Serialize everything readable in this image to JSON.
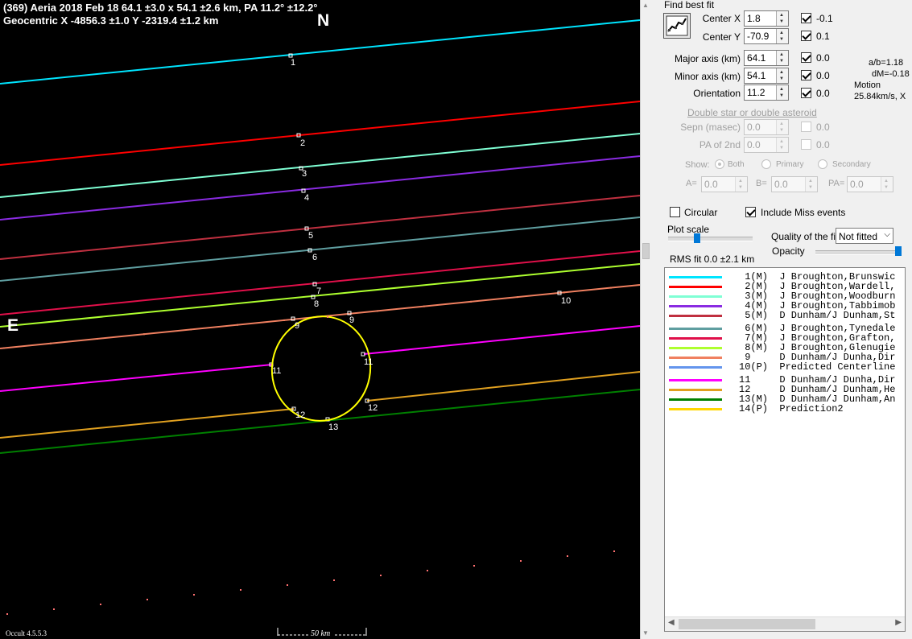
{
  "plot": {
    "title_line1": "(369) Aeria  2018 Feb 18   64.1 ±3.0 x 54.1 ±2.6 km,  PA 11.2° ±12.2°",
    "title_line2": "Geocentric  X  -4856.3 ±1.0  Y -2319.4 ±1.2 km",
    "north_label": "N",
    "east_label": "E",
    "version": "Occult 4.5.5.3",
    "scale_label": "50 km",
    "chord_numbers": [
      "1",
      "2",
      "3",
      "4",
      "5",
      "6",
      "7",
      "8",
      "9",
      "9",
      "10",
      "11",
      "11",
      "12",
      "12",
      "13"
    ],
    "colors": {
      "chord1": "#00e5ff",
      "chord2": "#ff0000",
      "chord3": "#7fffd4",
      "chord4": "#8a2be2",
      "chord5": "#c03040",
      "chord6": "#5f9ea0",
      "chord7": "#e0104a",
      "chord8": "#adff2f",
      "chord9": "#f08060",
      "chord11": "#ff00ff",
      "chord12": "#e0a020",
      "chord13": "#008000",
      "ellipse": "#ffff00"
    }
  },
  "panel": {
    "find_best_fit": "Find best fit",
    "fit_button_icon": "fit-graph-icon",
    "center_x": {
      "label": "Center X",
      "value": "1.8",
      "check_label": "-0.1",
      "checked": true
    },
    "center_y": {
      "label": "Center Y",
      "value": "-70.9",
      "check_label": "0.1",
      "checked": true
    },
    "major_axis": {
      "label": "Major axis (km)",
      "value": "64.1",
      "check_label": "0.0",
      "checked": true
    },
    "minor_axis": {
      "label": "Minor axis (km)",
      "value": "54.1",
      "check_label": "0.0",
      "checked": true
    },
    "orientation": {
      "label": "Orientation",
      "value": "11.2",
      "check_label": "0.0",
      "checked": true
    },
    "ab_ratio": "a/b=1.18",
    "dm": "dM=-0.18",
    "motion_label": "Motion",
    "motion_value": "25.84km/s, X",
    "double_star_link": "Double star  or  double asteroid",
    "sepn": {
      "label": "Sepn (masec)",
      "value": "0.0",
      "check_label": "0.0"
    },
    "pa_2nd": {
      "label": "PA of 2nd",
      "value": "0.0",
      "check_label": "0.0"
    },
    "show_label": "Show:",
    "show_options": [
      "Both",
      "Primary",
      "Secondary"
    ],
    "a_label": "A=",
    "a_value": "0.0",
    "b_label": "B=",
    "b_value": "0.0",
    "pa_label": "PA=",
    "pa_value": "0.0",
    "circular_label": "Circular",
    "circular_checked": false,
    "include_miss_label": "Include Miss events",
    "include_miss_checked": true,
    "plot_scale_label": "Plot scale",
    "quality_label": "Quality of the fit",
    "quality_value": "Not fitted",
    "opacity_label": "Opacity",
    "rms_fit": "RMS fit 0.0 ±2.1 km"
  },
  "legend": [
    {
      "text": " 1(M)  J Broughton,Brunswic",
      "color": "#00e5ff"
    },
    {
      "text": " 2(M)  J Broughton,Wardell,",
      "color": "#ff0000"
    },
    {
      "text": " 3(M)  J Broughton,Woodburn",
      "color": "#7fffd4"
    },
    {
      "text": " 4(M)  J Broughton,Tabbimob",
      "color": "#8a2be2"
    },
    {
      "text": " 5(M)  D Dunham/J Dunham,St",
      "color": "#c03040"
    },
    {
      "text": " 6(M)  J Broughton,Tynedale",
      "color": "#5f9ea0"
    },
    {
      "text": " 7(M)  J Broughton,Grafton,",
      "color": "#e0104a"
    },
    {
      "text": " 8(M)  J Broughton,Glenugie",
      "color": "#adff2f"
    },
    {
      "text": " 9     D Dunham/J Dunha,Dir",
      "color": "#f08060"
    },
    {
      "text": "10(P)  Predicted Centerline",
      "color": "#6495ed"
    },
    {
      "text": "11     D Dunham/J Dunha,Dir",
      "color": "#ff00ff"
    },
    {
      "text": "12     D Dunham/J Dunham,He",
      "color": "#e0a020"
    },
    {
      "text": "13(M)  D Dunham/J Dunham,An",
      "color": "#008000"
    },
    {
      "text": "14(P)  Prediction2",
      "color": "#ffd700"
    }
  ]
}
